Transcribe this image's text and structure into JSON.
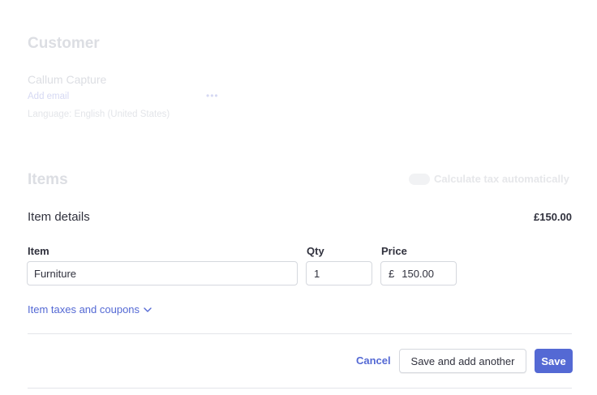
{
  "customer": {
    "section_title": "Customer",
    "name": "Callum Capture",
    "add_email_label": "Add email",
    "more_icon": "more-horizontal-icon",
    "language": "Language: English (United States)"
  },
  "items": {
    "section_title": "Items",
    "tax_toggle_label": "Calculate tax automatically",
    "tax_toggle_on": false
  },
  "item_details": {
    "title": "Item details",
    "total": "£150.00",
    "labels": {
      "item": "Item",
      "qty": "Qty",
      "price": "Price"
    },
    "values": {
      "item": "Furniture",
      "qty": "1",
      "currency_symbol": "£",
      "price": "150.00"
    },
    "taxes_link_label": "Item taxes and coupons",
    "taxes_link_icon": "chevron-down-icon"
  },
  "footer": {
    "cancel_label": "Cancel",
    "save_another_label": "Save and add another",
    "save_label": "Save"
  },
  "colors": {
    "accent": "#5469d4",
    "text": "#30313d",
    "border": "#d5d8de"
  }
}
